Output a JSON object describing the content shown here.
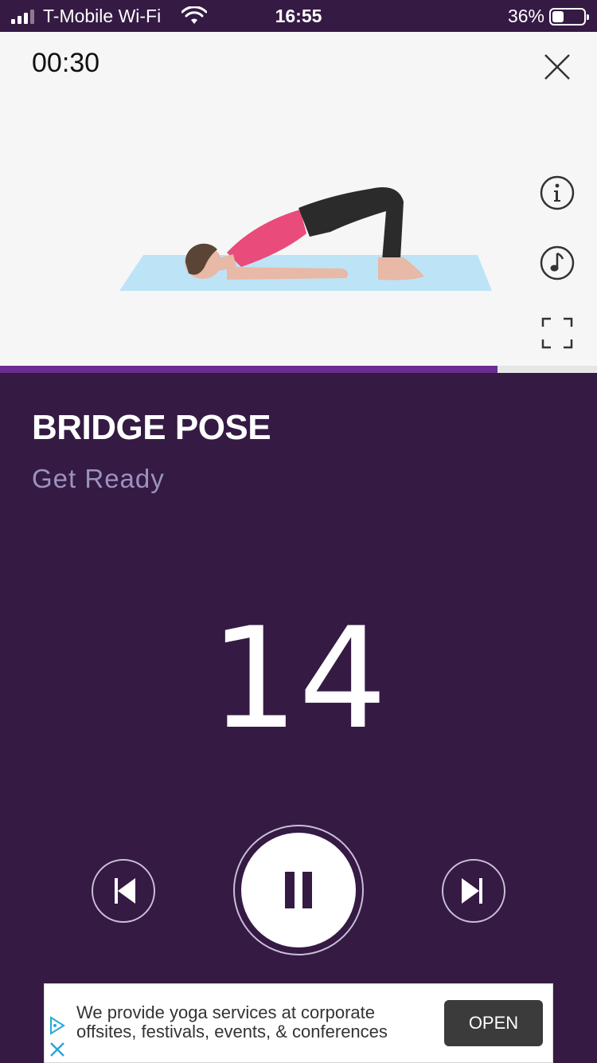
{
  "status_bar": {
    "carrier": "T-Mobile Wi-Fi",
    "time": "16:55",
    "battery_percent_text": "36%",
    "battery_level": 0.36,
    "signal_bars": 3,
    "signal_icon": "cellular-signal-icon",
    "wifi_icon": "wifi-icon",
    "battery_icon": "battery-icon"
  },
  "workout": {
    "elapsed": "00:30",
    "exercise_name": "BRIDGE POSE",
    "status": "Get Ready",
    "countdown": "14",
    "progress": 0.833
  },
  "media_controls": {
    "close_icon": "close-icon",
    "info_icon": "info-icon",
    "music_icon": "music-note-icon",
    "fullscreen_icon": "fullscreen-icon"
  },
  "playback": {
    "previous_icon": "skip-previous-icon",
    "pause_icon": "pause-icon",
    "next_icon": "skip-next-icon"
  },
  "ad": {
    "text": "We provide yoga services at corporate offsites, festivals, events, & conferences",
    "button_label": "OPEN",
    "adchoices_icon": "adchoices-icon",
    "close_icon": "ad-close-icon"
  },
  "colors": {
    "background": "#351a44",
    "accent": "#6a2c91",
    "status_text": "#9a93bd",
    "media_bg": "#f6f6f6"
  }
}
